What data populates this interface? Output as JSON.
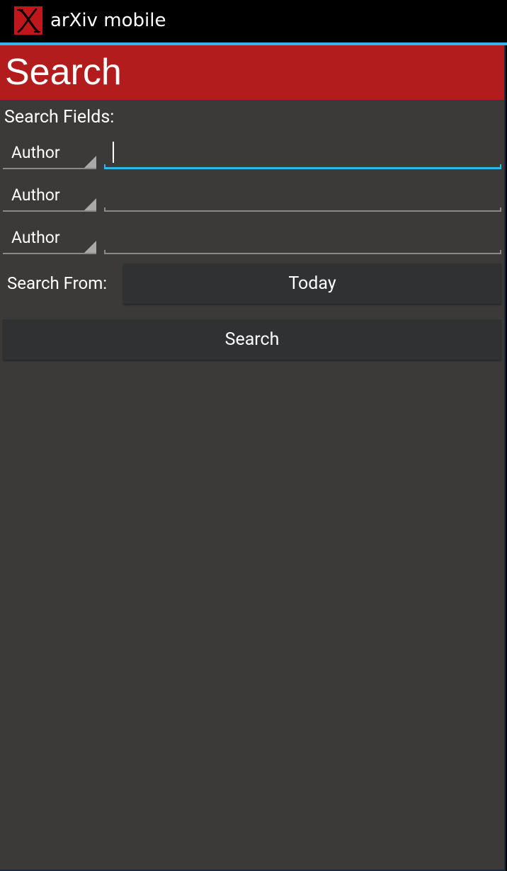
{
  "action_bar": {
    "app_title": "arXiv mobile",
    "app_icon": "arxiv-x-logo-icon"
  },
  "header": {
    "title": "Search"
  },
  "search_fields": {
    "label": "Search Fields:",
    "rows": [
      {
        "field_type": "Author",
        "value": "",
        "focused": true
      },
      {
        "field_type": "Author",
        "value": "",
        "focused": false
      },
      {
        "field_type": "Author",
        "value": "",
        "focused": false
      }
    ]
  },
  "search_from": {
    "label": "Search From:",
    "value": "Today"
  },
  "search_button": {
    "label": "Search"
  },
  "colors": {
    "accent": "#33b5e5",
    "banner": "#b21c1c",
    "background": "#3b3a39",
    "button": "#2f3133"
  }
}
